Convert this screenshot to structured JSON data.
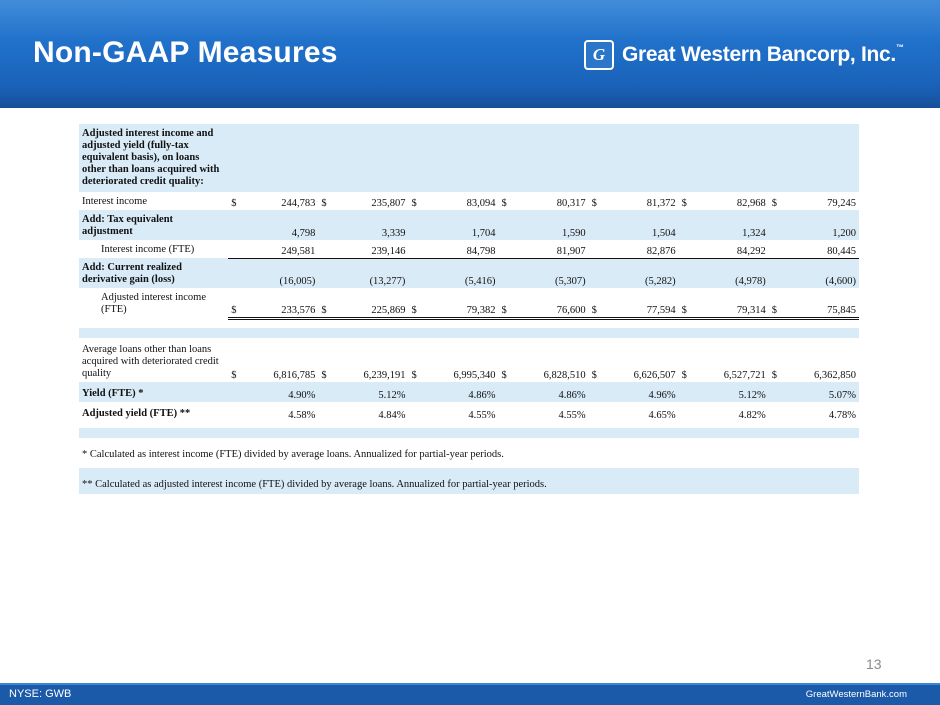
{
  "header": {
    "title": "Non-GAAP Measures",
    "logo_mark": "G",
    "logo_text": "Great Western Bancorp, Inc."
  },
  "table": {
    "section_title": "Adjusted interest income and adjusted yield (fully-tax equivalent basis), on loans other than loans acquired with deteriorated credit quality:",
    "currency_symbol": "$",
    "rows": [
      {
        "label": "Interest income",
        "values": [
          "244,783",
          "235,807",
          "83,094",
          "80,317",
          "81,372",
          "82,968",
          "79,245"
        ]
      },
      {
        "label": "Add: Tax equivalent adjustment",
        "values": [
          "4,798",
          "3,339",
          "1,704",
          "1,590",
          "1,504",
          "1,324",
          "1,200"
        ]
      },
      {
        "label": "Interest income (FTE)",
        "values": [
          "249,581",
          "239,146",
          "84,798",
          "81,907",
          "82,876",
          "84,292",
          "80,445"
        ]
      },
      {
        "label": "Add: Current realized derivative gain (loss)",
        "values": [
          "(16,005)",
          "(13,277)",
          "(5,416)",
          "(5,307)",
          "(5,282)",
          "(4,978)",
          "(4,600)"
        ]
      },
      {
        "label": "Adjusted interest income (FTE)",
        "values": [
          "233,576",
          "225,869",
          "79,382",
          "76,600",
          "77,594",
          "79,314",
          "75,845"
        ]
      },
      {
        "label": "Average loans other than loans acquired with deteriorated credit quality",
        "values": [
          "6,816,785",
          "6,239,191",
          "6,995,340",
          "6,828,510",
          "6,626,507",
          "6,527,721",
          "6,362,850"
        ]
      },
      {
        "label": "Yield (FTE) *",
        "values": [
          "4.90%",
          "5.12%",
          "4.86%",
          "4.86%",
          "4.96%",
          "5.12%",
          "5.07%"
        ]
      },
      {
        "label": "Adjusted yield (FTE) **",
        "values": [
          "4.58%",
          "4.84%",
          "4.55%",
          "4.55%",
          "4.65%",
          "4.82%",
          "4.78%"
        ]
      }
    ],
    "footnotes": [
      "* Calculated as interest income (FTE) divided by average loans. Annualized for partial-year periods.",
      "** Calculated as adjusted interest income (FTE) divided by average loans. Annualized for partial-year periods."
    ]
  },
  "page_number": "13",
  "footer": {
    "ticker": "NYSE: GWB",
    "website": "GreatWesternBank.com"
  }
}
